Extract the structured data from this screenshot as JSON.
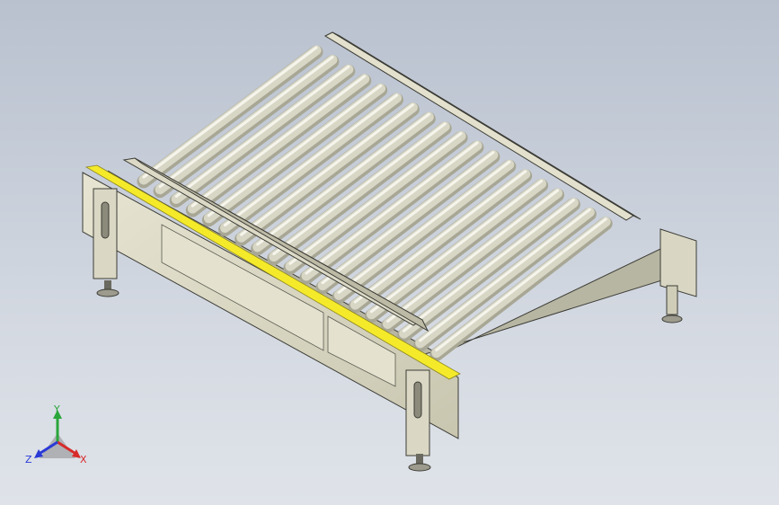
{
  "viewport": {
    "background_top": "#b9c1cf",
    "background_bottom": "#dfe3e9"
  },
  "model": {
    "roller_count": 19,
    "colors": {
      "roller": "#d8d7c6",
      "roller_shade": "#a8a795",
      "frame": "#dedcc8",
      "frame_dark": "#b9b6a0",
      "highlight": "#f4ea2a",
      "edge": "#3c3c36"
    }
  },
  "triad": {
    "x_label": "X",
    "y_label": "Y",
    "z_label": "Z",
    "x_color": "#d62a2a",
    "y_color": "#2aa63a",
    "z_color": "#2a3ad6"
  }
}
